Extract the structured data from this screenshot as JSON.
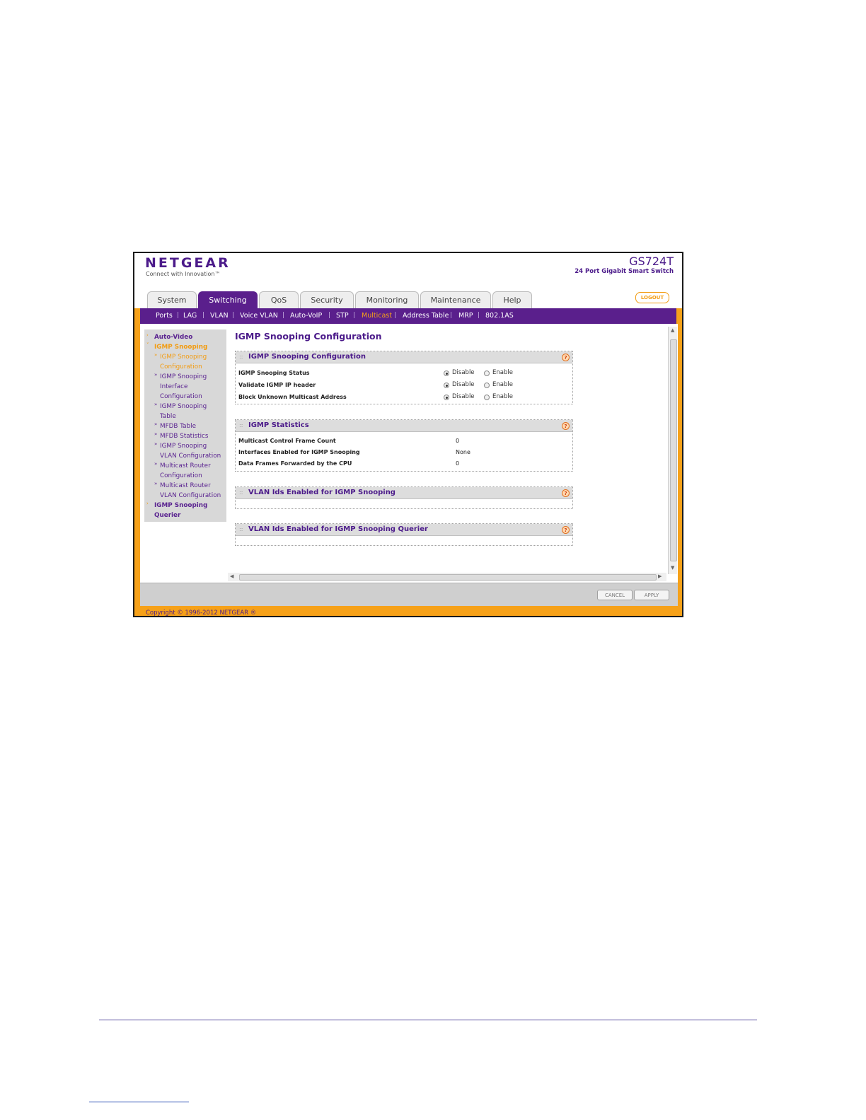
{
  "brand": {
    "logo": "NETGEAR",
    "tagline": "Connect with Innovation™",
    "model": "GS724T",
    "model_desc": "24 Port Gigabit Smart Switch"
  },
  "tabs": [
    {
      "label": "System",
      "active": false
    },
    {
      "label": "Switching",
      "active": true
    },
    {
      "label": "QoS",
      "active": false
    },
    {
      "label": "Security",
      "active": false
    },
    {
      "label": "Monitoring",
      "active": false
    },
    {
      "label": "Maintenance",
      "active": false
    },
    {
      "label": "Help",
      "active": false
    }
  ],
  "logout_label": "LOGOUT",
  "subnav": [
    {
      "label": "Ports"
    },
    {
      "label": "LAG"
    },
    {
      "label": "VLAN"
    },
    {
      "label": "Voice VLAN"
    },
    {
      "label": "Auto-VoIP"
    },
    {
      "label": "STP"
    },
    {
      "label": "Multicast",
      "active": true
    },
    {
      "label": "Address Table"
    },
    {
      "label": "MRP"
    },
    {
      "label": "802.1AS"
    }
  ],
  "sidebar": {
    "items": [
      {
        "label": "Auto-Video"
      },
      {
        "label": "IGMP Snooping"
      },
      {
        "label": "IGMP Snooping"
      },
      {
        "label": "Configuration"
      },
      {
        "label": "IGMP Snooping"
      },
      {
        "label": "Interface"
      },
      {
        "label": "Configuration"
      },
      {
        "label": "IGMP Snooping"
      },
      {
        "label": "Table"
      },
      {
        "label": "MFDB Table"
      },
      {
        "label": "MFDB Statistics"
      },
      {
        "label": "IGMP Snooping"
      },
      {
        "label": "VLAN Configuration"
      },
      {
        "label": "Multicast Router"
      },
      {
        "label": "Configuration"
      },
      {
        "label": "Multicast Router"
      },
      {
        "label": "VLAN Configuration"
      },
      {
        "label": "IGMP Snooping"
      },
      {
        "label": "Querier"
      }
    ]
  },
  "page_title": "IGMP Snooping Configuration",
  "config_panel": {
    "title": "IGMP Snooping Configuration",
    "rows": [
      {
        "label": "IGMP Snooping Status",
        "opt1": "Disable",
        "opt2": "Enable",
        "selected": "Disable"
      },
      {
        "label": "Validate IGMP IP header",
        "opt1": "Disable",
        "opt2": "Enable",
        "selected": "Disable"
      },
      {
        "label": "Block Unknown Multicast Address",
        "opt1": "Disable",
        "opt2": "Enable",
        "selected": "Disable"
      }
    ]
  },
  "stats_panel": {
    "title": "IGMP Statistics",
    "rows": [
      {
        "label": "Multicast Control Frame Count",
        "value": "0"
      },
      {
        "label": "Interfaces Enabled for IGMP Snooping",
        "value": "None"
      },
      {
        "label": "Data Frames Forwarded by the CPU",
        "value": "0"
      }
    ]
  },
  "vlan_panel": {
    "title": "VLAN Ids Enabled for IGMP Snooping"
  },
  "querier_panel": {
    "title": "VLAN Ids Enabled for IGMP Snooping Querier"
  },
  "buttons": {
    "cancel": "CANCEL",
    "apply": "APPLY"
  },
  "copyright": "Copyright © 1996-2012 NETGEAR ®",
  "help_glyph": "?",
  "colors": {
    "brand_purple": "#5a1f8c",
    "brand_orange": "#f6a119"
  }
}
